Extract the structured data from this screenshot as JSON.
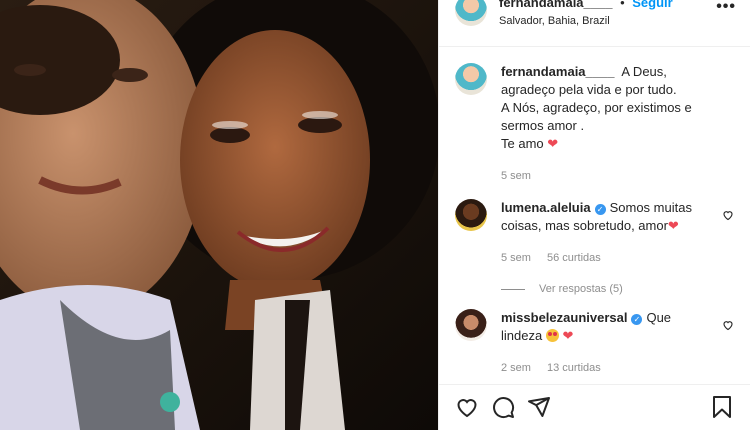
{
  "post": {
    "author": "fernandamaia____",
    "separator": "•",
    "follow_label": "Seguir",
    "location": "Salvador, Bahia, Brazil",
    "more_label": "•••"
  },
  "caption": {
    "username": "fernandamaia____",
    "line1": "A Deus, agradeço pela vida e por tudo.",
    "line2": "A Nós, agradeço, por existimos e sermos amor .",
    "line3": "Te amo",
    "time": "5 sem"
  },
  "comments": [
    {
      "username": "lumena.aleluia",
      "text": "Somos muitas coisas, mas sobretudo, amor",
      "time": "5 sem",
      "likes": "56 curtidas",
      "replies_label": "Ver respostas (5)"
    },
    {
      "username": "missbelezauniversal",
      "text": "Que lindeza",
      "time": "2 sem",
      "likes": "13 curtidas"
    }
  ],
  "icons": {
    "heart": "heart-icon",
    "comment": "comment-icon",
    "share": "share-icon",
    "save": "bookmark-icon"
  },
  "colors": {
    "link_blue": "#0095f6",
    "verified_blue": "#3897f0",
    "heart_red": "#ed4956",
    "muted": "#8e8e8e"
  }
}
